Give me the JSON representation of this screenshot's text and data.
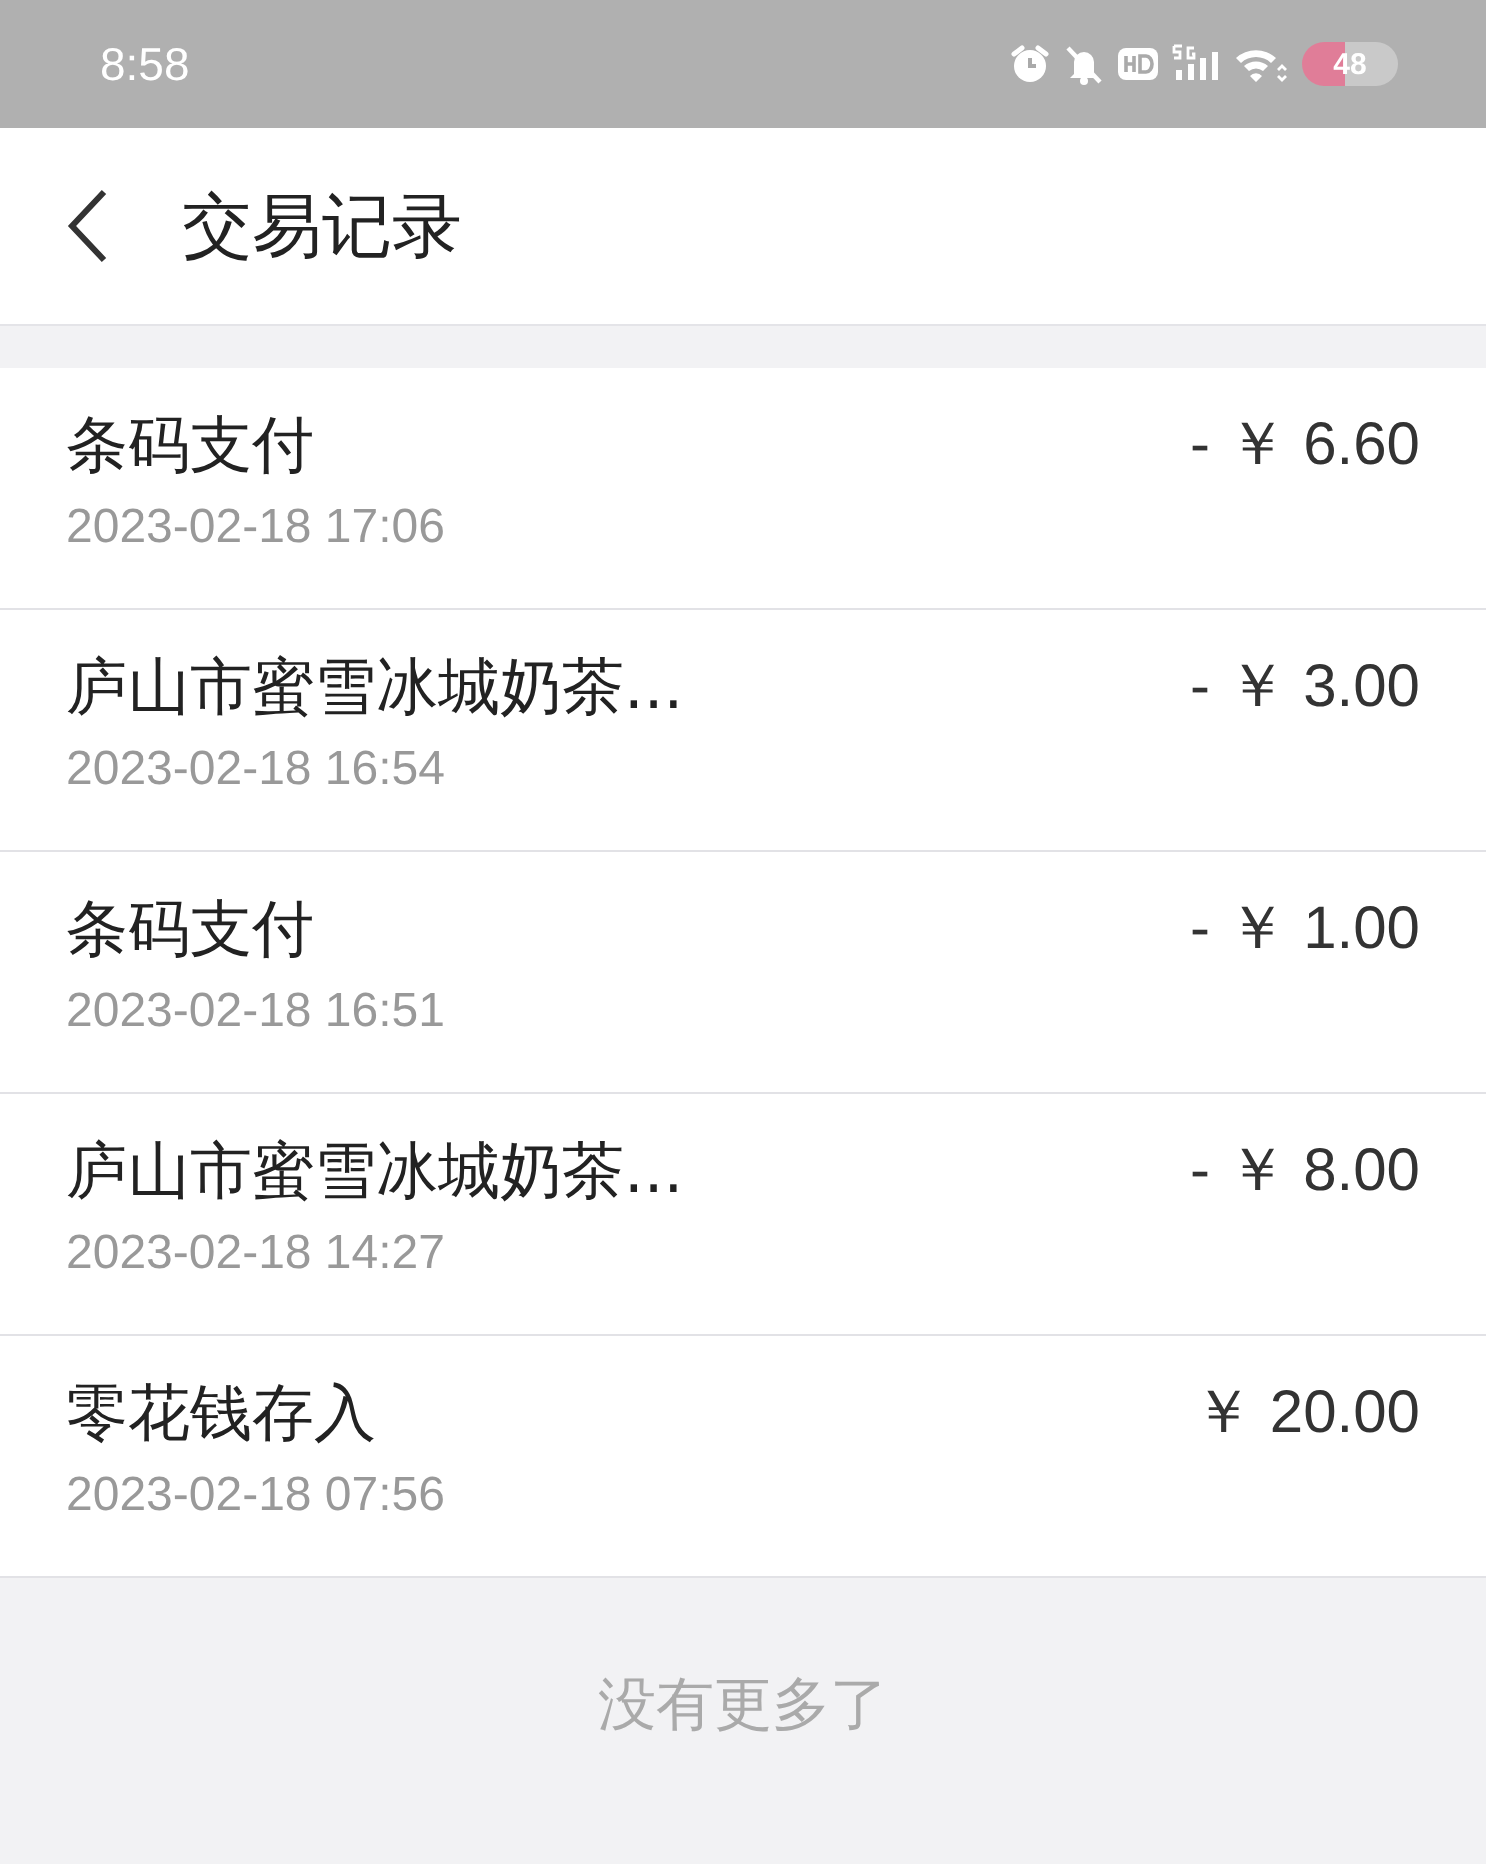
{
  "status_bar": {
    "time": "8:58",
    "battery": "48"
  },
  "header": {
    "title": "交易记录"
  },
  "transactions": [
    {
      "name": "条码支付",
      "time": "2023-02-18 17:06",
      "amount": "- ￥ 6.60"
    },
    {
      "name": "庐山市蜜雪冰城奶茶...",
      "time": "2023-02-18 16:54",
      "amount": "- ￥ 3.00"
    },
    {
      "name": "条码支付",
      "time": "2023-02-18 16:51",
      "amount": "- ￥ 1.00"
    },
    {
      "name": "庐山市蜜雪冰城奶茶...",
      "time": "2023-02-18 14:27",
      "amount": "- ￥ 8.00"
    },
    {
      "name": "零花钱存入",
      "time": "2023-02-18 07:56",
      "amount": "￥ 20.00"
    }
  ],
  "footer": {
    "text": "没有更多了"
  }
}
